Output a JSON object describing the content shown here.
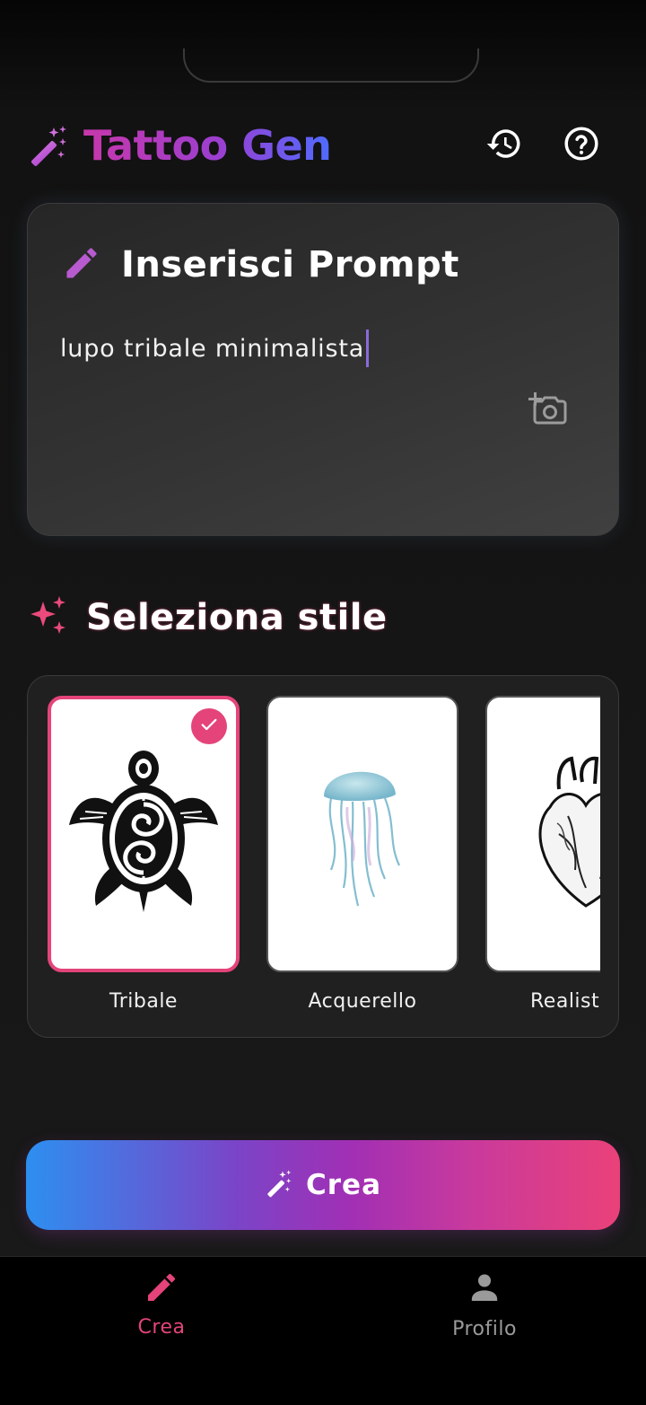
{
  "header": {
    "app_title": "Tattoo Gen",
    "logo_icon": "magic-wand-icon",
    "history_icon": "history-icon",
    "help_icon": "help-circle-icon"
  },
  "prompt": {
    "title": "Inserisci Prompt",
    "title_icon": "pencil-icon",
    "value": "lupo tribale minimalista",
    "camera_icon": "add-photo-camera-icon"
  },
  "styles": {
    "title": "Seleziona stile",
    "title_icon": "sparkles-icon",
    "items": [
      {
        "label": "Tribale",
        "image": "tribal-turtle",
        "selected": true
      },
      {
        "label": "Acquerello",
        "image": "watercolor-jellyfish",
        "selected": false
      },
      {
        "label": "Realist",
        "image": "realistic-heart",
        "selected": false
      }
    ]
  },
  "create_button": {
    "label": "Crea",
    "icon": "magic-wand-icon"
  },
  "bottom_nav": {
    "items": [
      {
        "label": "Crea",
        "icon": "pencil-icon",
        "active": true
      },
      {
        "label": "Profilo",
        "icon": "person-icon",
        "active": false
      }
    ]
  },
  "colors": {
    "accent_pink": "#e4447a",
    "accent_purple": "#a84fd0",
    "accent_blue": "#2d8ff0",
    "inactive_nav": "#9a9a9a",
    "background": "#121212"
  }
}
